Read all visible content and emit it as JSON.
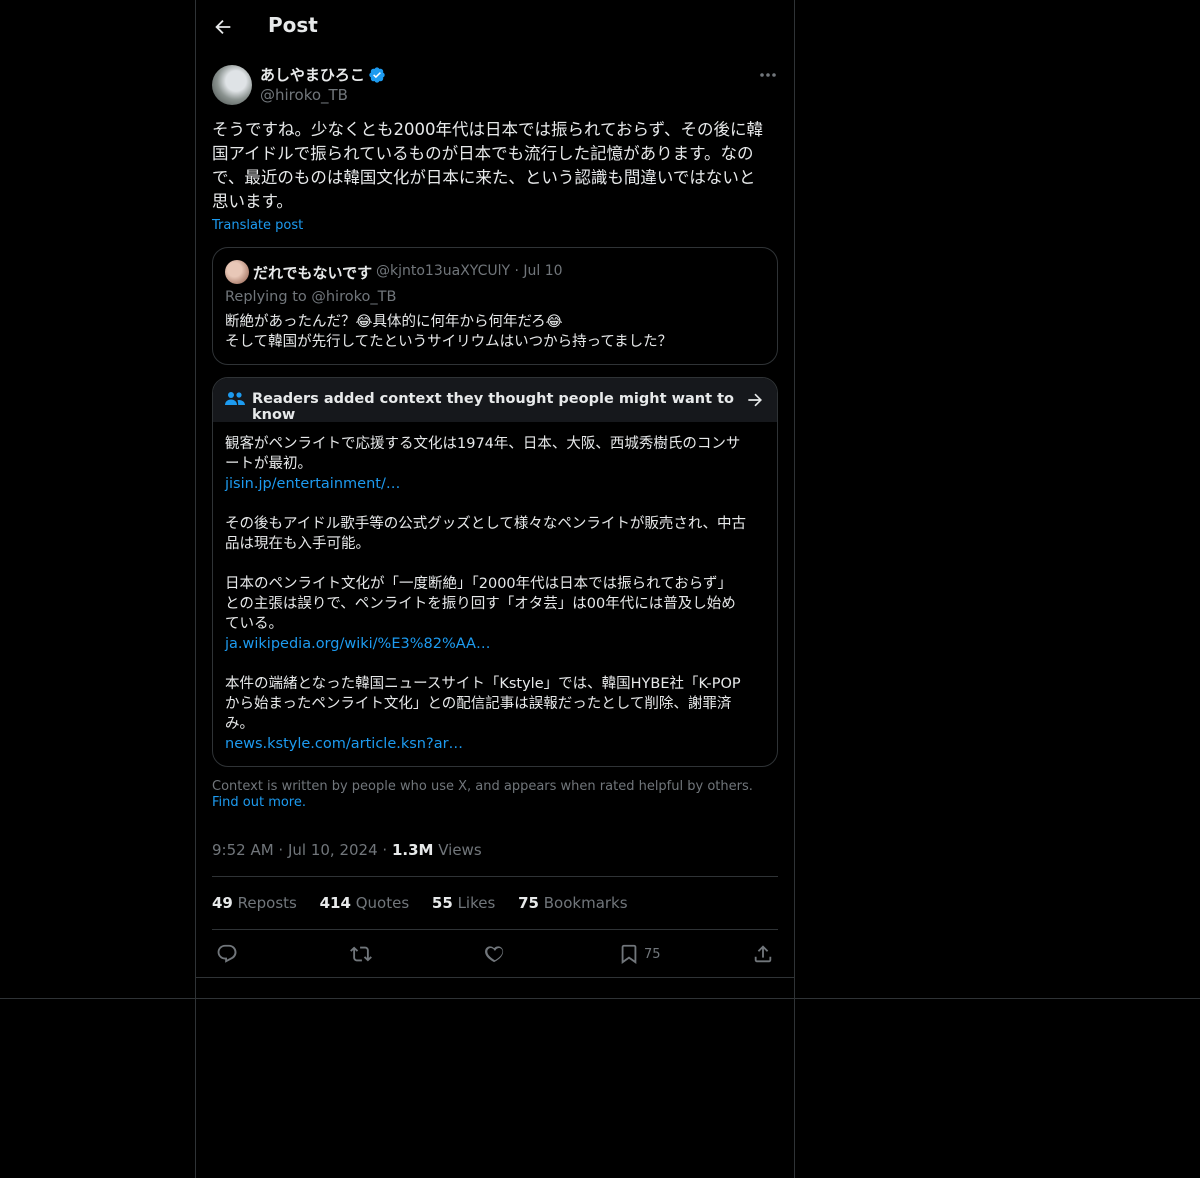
{
  "header": {
    "title": "Post"
  },
  "author": {
    "display_name": "あしやまひろこ",
    "handle": "@hiroko_TB"
  },
  "post": {
    "text": "そうですね。少なくとも2000年代は日本では振られておらず、その後に韓\n国アイドルで振られているものが日本でも流行した記憶があります。なの\nで、最近のものは韓国文化が日本に来た、という認識も間違いではないと\n思います。",
    "translate_label": "Translate post"
  },
  "quoted": {
    "display_name": "だれでもないです",
    "handle": "@kjnto13uaXYCUlY",
    "date": "Jul 10",
    "replying_to": "Replying to @hiroko_TB",
    "text": "断絶があったんだ？😂具体的に何年から何年だろ😂\nそして韓国が先行してたというサイリウムはいつから持ってました？"
  },
  "community_note": {
    "title": "Readers added context they thought people might want to know",
    "p1": "観客がペンライトで応援する文化は1974年、日本、大阪、西城秀樹氏のコンサ\nートが最初。",
    "link1": "jisin.jp/entertainment/…",
    "p2": "その後もアイドル歌手等の公式グッズとして様々なペンライトが販売され、中古\n品は現在も入手可能。",
    "p3": "日本のペンライト文化が「一度断絶」「2000年代は日本では振られておらず」\nとの主張は誤りで、ペンライトを振り回す「オタ芸」は00年代には普及し始め\nている。",
    "link2": "ja.wikipedia.org/wiki/%E3%82%AA…",
    "p4": "本件の端緒となった韓国ニュースサイト「Kstyle」では、韓国HYBE社「K-POP\nから始まったペンライト文化」との配信記事は誤報だったとして削除、謝罪済\nみ。",
    "link3": "news.kstyle.com/article.ksn?ar…"
  },
  "context_footer": {
    "text": "Context is written by people who use X, and appears when rated helpful by others.",
    "link": "Find out more."
  },
  "meta": {
    "time": "9:52 AM",
    "date": "Jul 10, 2024",
    "views_count": "1.3M",
    "views_label": "Views"
  },
  "stats": {
    "reposts_count": "49",
    "reposts_label": "Reposts",
    "quotes_count": "414",
    "quotes_label": "Quotes",
    "likes_count": "55",
    "likes_label": "Likes",
    "bookmarks_count": "75",
    "bookmarks_label": "Bookmarks"
  },
  "actions": {
    "bookmark_count": "75"
  },
  "colors": {
    "accent": "#1d9bf0",
    "background": "#000000",
    "border": "#2f3336",
    "muted": "#71767b",
    "text": "#e7e9ea"
  },
  "icons": [
    "back-arrow-icon",
    "verified-badge-icon",
    "more-icon",
    "people-icon",
    "arrow-right-icon",
    "reply-icon",
    "repost-icon",
    "like-icon",
    "bookmark-icon",
    "share-icon"
  ]
}
